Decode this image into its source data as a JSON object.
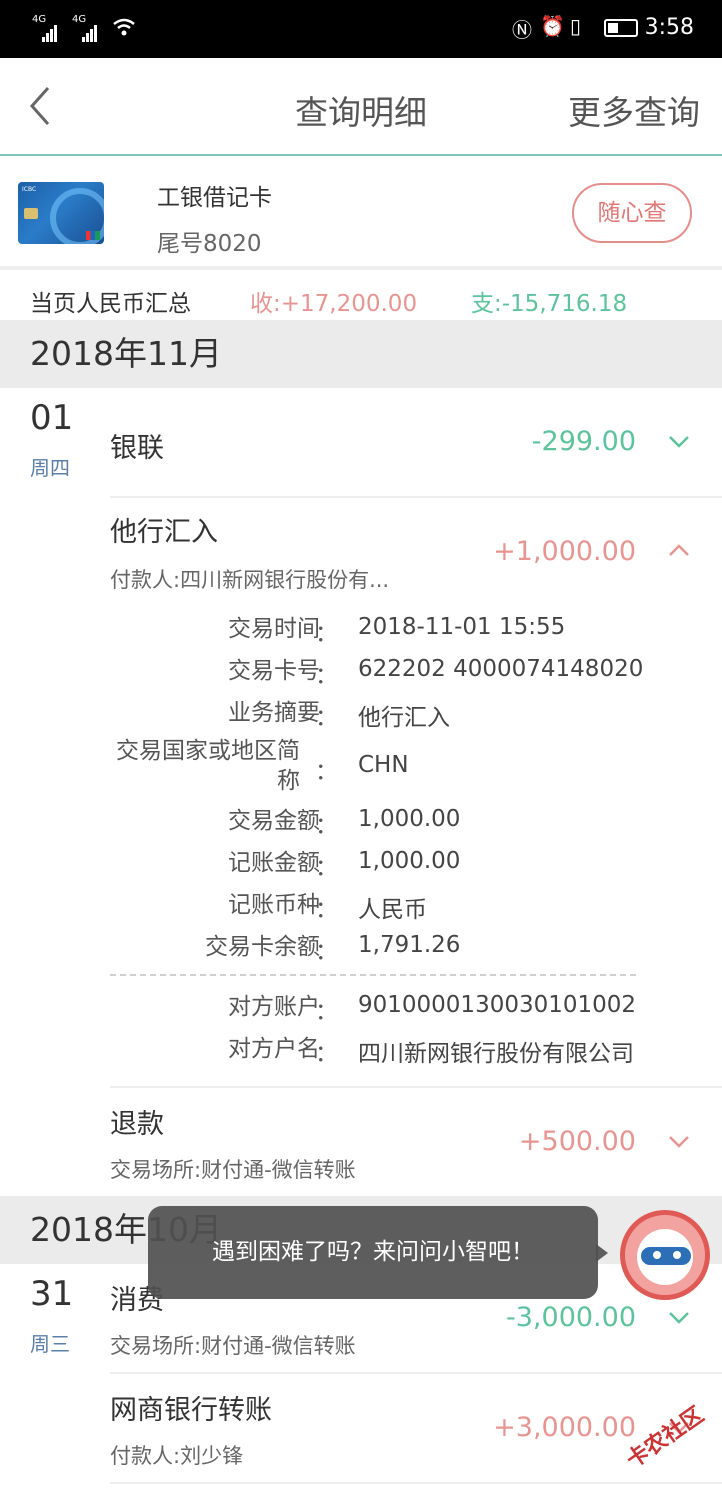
{
  "status_bar": {
    "sim1": "4G",
    "sim2": "4G",
    "time": "3:58"
  },
  "nav": {
    "title": "查询明细",
    "more": "更多查询"
  },
  "card": {
    "name": "工银借记卡",
    "tail": "尾号8020",
    "button": "随心查"
  },
  "summary": {
    "label": "当页人民币汇总",
    "income": "收:+17,200.00",
    "expense": "支:-15,716.18"
  },
  "months": [
    {
      "label": "2018年11月"
    },
    {
      "label": "2018年10月"
    }
  ],
  "days": [
    {
      "day": "01",
      "weekday": "周四"
    },
    {
      "day": "31",
      "weekday": "周三"
    }
  ],
  "transactions": [
    {
      "name": "银联",
      "sub": "",
      "amount": "-299.00"
    },
    {
      "name": "他行汇入",
      "sub": "付款人:四川新网银行股份有...",
      "amount": "+1,000.00"
    },
    {
      "name": "退款",
      "sub": "交易场所:财付通-微信转账",
      "amount": "+500.00"
    },
    {
      "name": "消费",
      "sub": "交易场所:财付通-微信转账",
      "amount": "-3,000.00"
    },
    {
      "name": "网商银行转账",
      "sub": "付款人:刘少锋",
      "amount": "+3,000.00"
    }
  ],
  "detail": {
    "colon": "：",
    "rows": [
      {
        "key": "交易时间",
        "value": "2018-11-01 15:55"
      },
      {
        "key": "交易卡号",
        "value": "622202 4000074148020"
      },
      {
        "key": "业务摘要",
        "value": "他行汇入"
      },
      {
        "key": "交易国家或地区简称",
        "value": "CHN"
      },
      {
        "key": "交易金额",
        "value": "1,000.00"
      },
      {
        "key": "记账金额",
        "value": "1,000.00"
      },
      {
        "key": "记账币种",
        "value": "人民币"
      },
      {
        "key": "交易卡余额",
        "value": "1,791.26"
      },
      {
        "key": "对方账户",
        "value": "9010000130030101002"
      },
      {
        "key": "对方户名",
        "value": "四川新网银行股份有限公司"
      }
    ]
  },
  "assistant": {
    "tip": "遇到困难了吗？来问问小智吧！"
  },
  "watermark": "卡农社区",
  "colors": {
    "income": "#e89491",
    "expense": "#5cc39c",
    "accent_line": "#7fc4bd",
    "button_border": "#e58d8b"
  }
}
